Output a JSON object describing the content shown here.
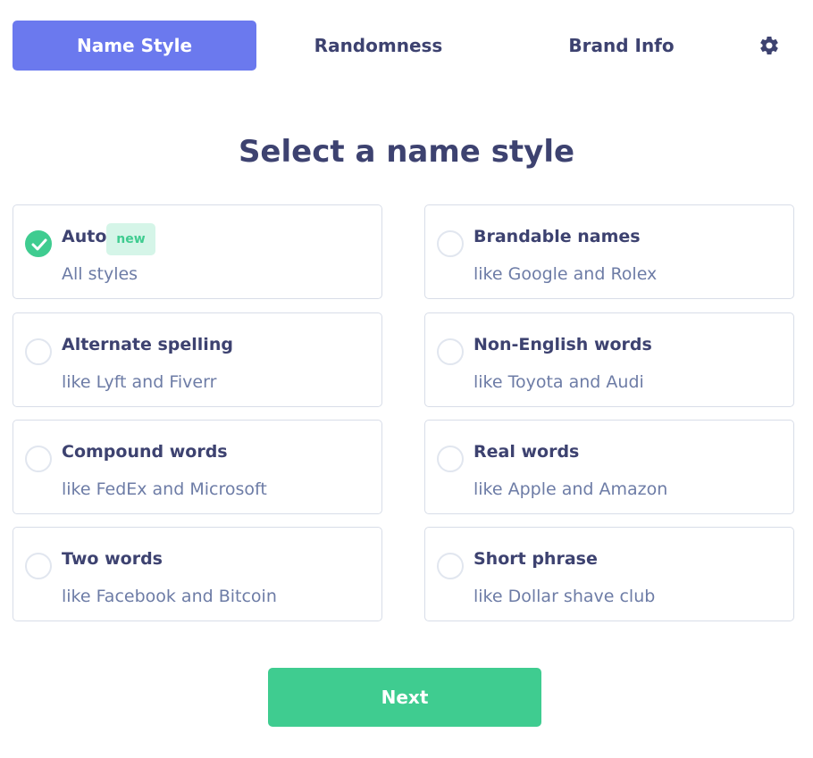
{
  "tabs": [
    {
      "label": "Name Style",
      "active": true
    },
    {
      "label": "Randomness",
      "active": false
    },
    {
      "label": "Brand Info",
      "active": false
    }
  ],
  "settings_icon": "gear-icon",
  "heading": "Select a name style",
  "options": [
    {
      "label": "Auto",
      "description": "All styles",
      "badge": "new",
      "selected": true
    },
    {
      "label": "Brandable names",
      "description": "like Google and Rolex",
      "selected": false
    },
    {
      "label": "Alternate spelling",
      "description": "like Lyft and Fiverr",
      "selected": false
    },
    {
      "label": "Non-English words",
      "description": "like Toyota and Audi",
      "selected": false
    },
    {
      "label": "Compound words",
      "description": "like FedEx and Microsoft",
      "selected": false
    },
    {
      "label": "Real words",
      "description": "like Apple and Amazon",
      "selected": false
    },
    {
      "label": "Two words",
      "description": "like Facebook and Bitcoin",
      "selected": false
    },
    {
      "label": "Short phrase",
      "description": "like Dollar shave club",
      "selected": false
    }
  ],
  "next_label": "Next",
  "colors": {
    "accent": "#6b79ee",
    "success": "#3fcc90",
    "text": "#3d4270",
    "muted": "#6d7ca6"
  }
}
